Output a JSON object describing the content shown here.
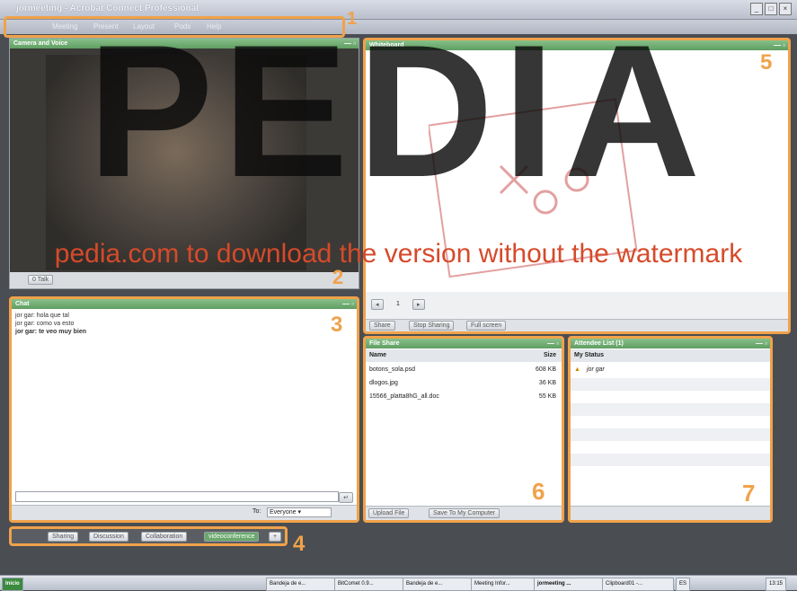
{
  "window": {
    "title": "jormeeting - Acrobat Connect Professional",
    "controls": [
      "_",
      "□",
      "×"
    ]
  },
  "menu": [
    "Meeting",
    "Present",
    "Layout",
    "Pods",
    "Help"
  ],
  "video_pod": {
    "title": "Camera and Voice",
    "talk_label": "0 Talk",
    "callout": "2"
  },
  "whiteboard": {
    "title": "Whiteboard",
    "page": "1",
    "share": "Share",
    "stop_sharing": "Stop Sharing",
    "full_screen": "Full screen",
    "callout": "5"
  },
  "chat": {
    "title": "Chat",
    "messages": [
      {
        "user": "jor gar:",
        "text": "hola que tal"
      },
      {
        "user": "jor gar:",
        "text": "como va esto"
      },
      {
        "user": "jor gar:",
        "text": "te veo muy bien"
      }
    ],
    "to_label": "To:",
    "to_value": "Everyone",
    "callout": "3"
  },
  "tabs": {
    "items": [
      "Sharing",
      "Discussion",
      "Collaboration",
      "videoconference"
    ],
    "active": "videoconference",
    "add": "+",
    "callout": "4"
  },
  "fileshare": {
    "title": "File Share",
    "headers": [
      "Name",
      "Size"
    ],
    "rows": [
      {
        "name": "botons_sola.psd",
        "size": "608 KB"
      },
      {
        "name": "dlogos.jpg",
        "size": "36 KB"
      },
      {
        "name": "15566_platta8hG_all.doc",
        "size": "55 KB"
      }
    ],
    "upload": "Upload File",
    "save": "Save To My Computer",
    "callout": "6"
  },
  "attendees": {
    "title": "Attendee List (1)",
    "status_header": "My Status",
    "people": [
      "jor gar"
    ],
    "callout": "7"
  },
  "taskbar": {
    "start": "Inicio",
    "items": [
      "Bandeja de e...",
      "BitComet 0.9...",
      "Bandeja de e...",
      "Meeting Infor...",
      "jormeeting ...",
      "Clipboard01 -..."
    ],
    "lang": "ES",
    "clock": "13:15"
  },
  "watermark": {
    "big": "PEDIA",
    "line": "pedia.com to download the version without the watermark"
  },
  "colors": {
    "callout": "#f0a24a",
    "pod_header": "#6aa86d"
  }
}
